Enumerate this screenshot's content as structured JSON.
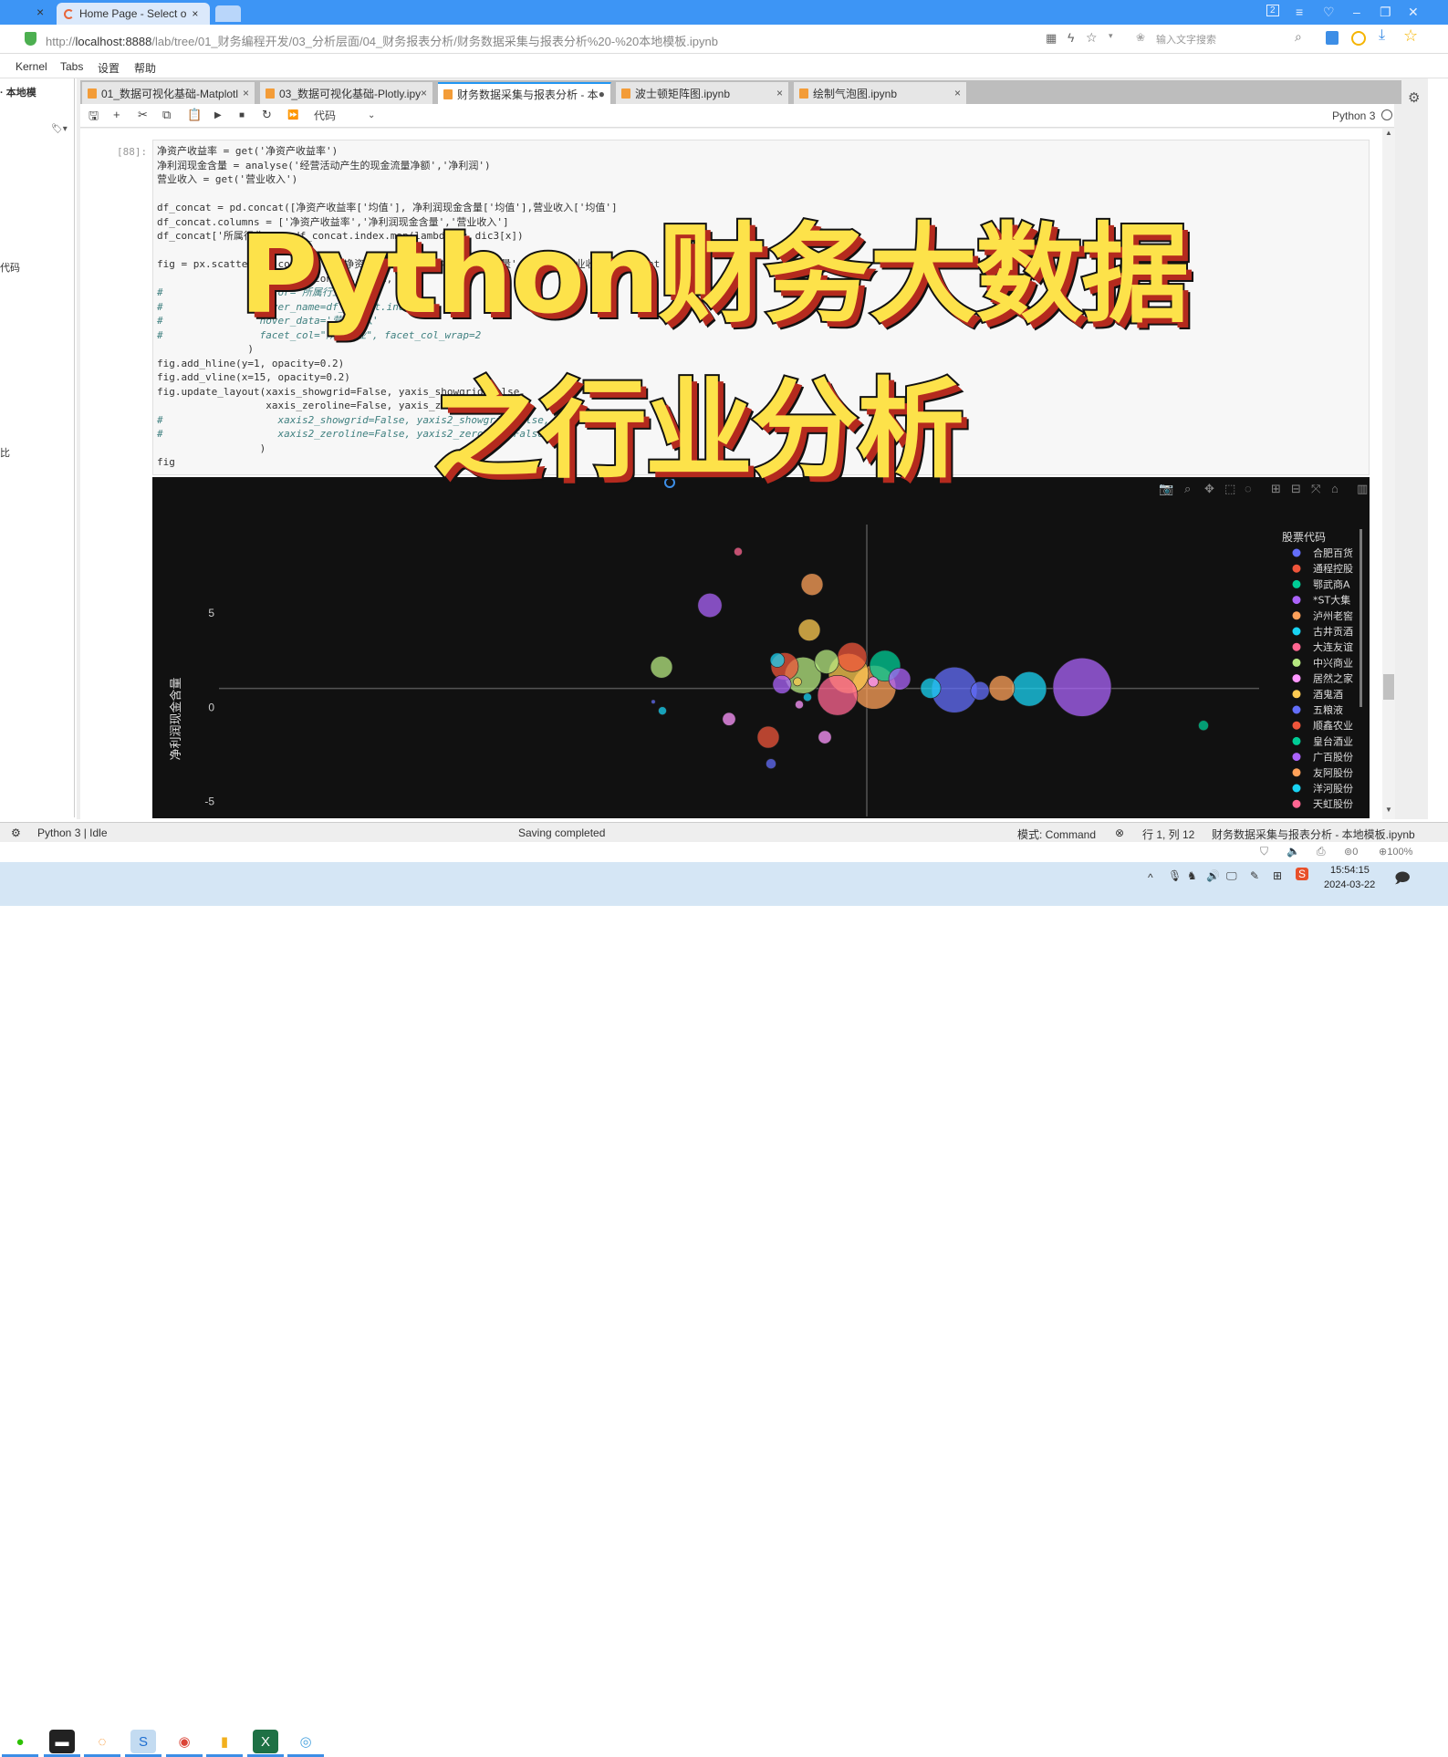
{
  "browser": {
    "tabs": [
      {
        "label": "Home Page - Select o",
        "close": "×"
      }
    ],
    "prev_tab_close": "×",
    "url_prefix": "http://",
    "url_host": "localhost:8888",
    "url_path": "/lab/tree/01_财务编程开发/03_分析层面/04_财务报表分析/财务数据采集与报表分析%20-%20本地模板.ipynb",
    "search_placeholder": "输入文字搜索",
    "window_badge": "2",
    "zoom": "100%",
    "block_count": "0"
  },
  "menu": [
    "Kernel",
    "Tabs",
    "设置",
    "帮助"
  ],
  "sidebar": {
    "items": [
      "· 本地模",
      "代码",
      "比"
    ]
  },
  "notebook_tabs": [
    {
      "label": "01_数据可视化基础-Matplotl",
      "close": "×"
    },
    {
      "label": "03_数据可视化基础-Plotly.ipy",
      "close": "×"
    },
    {
      "label": "财务数据采集与报表分析 - 本",
      "close": "●",
      "active": true
    },
    {
      "label": "波士顿矩阵图.ipynb",
      "close": "×"
    },
    {
      "label": "绘制气泡图.ipynb",
      "close": "×"
    }
  ],
  "toolbar": {
    "cell_type": "代码",
    "kernel": "Python 3"
  },
  "cell": {
    "prompt": "[88]:",
    "lines": [
      "净资产收益率 = get('净资产收益率')",
      "净利润现金含量 = analyse('经营活动产生的现金流量净额','净利润')",
      "营业收入 = get('营业收入')",
      "",
      "df_concat = pd.concat([净资产收益率['均值'], 净利润现金含量['均值'],营业收入['均值']",
      "df_concat.columns = ['净资产收益率','净利润现金含量','营业收入']",
      "df_concat['所属行业'] = df_concat.index.map(lambda x: dic3[x])",
      "",
      "fig = px.scatter(df_concat, x='净资产收益率', y='净利润现金含量', size='营业收入', height",
      "                 color=df_concat.index,",
      "#                color='所属行业',",
      "#                hover_name=df_concat.index,",
      "#                hover_data='营业收入'",
      "#                facet_col=\"所属行业\", facet_col_wrap=2",
      "               )",
      "fig.add_hline(y=1, opacity=0.2)",
      "fig.add_vline(x=15, opacity=0.2)",
      "fig.update_layout(xaxis_showgrid=False, yaxis_showgrid=False,",
      "                  xaxis_zeroline=False, yaxis_zeroline=False,",
      "#                   xaxis2_showgrid=False, yaxis2_showgrid=False,",
      "#                   xaxis2_zeroline=False, yaxis2_zeroline=False",
      "                 )",
      "fig"
    ]
  },
  "overlay": {
    "line1": "Python财务大数据",
    "line2": "之行业分析"
  },
  "chart_data": {
    "type": "scatter",
    "ylabel": "净利润现金含量",
    "yticks": [
      "5",
      "0",
      "-5"
    ],
    "ylim": [
      -5.8,
      9.7
    ],
    "xlim": [
      -20.5,
      36.5
    ],
    "hline_y": 1,
    "vline_x": 15,
    "grid": false,
    "legend_title": "股票代码",
    "legend_placement": "right",
    "legend": [
      "合肥百货",
      "通程控股",
      "鄂武商A",
      "*ST大集",
      "泸州老窖",
      "古井贡酒",
      "大连友谊",
      "中兴商业",
      "居然之家",
      "酒鬼酒",
      "五粮液",
      "顺鑫农业",
      "皇台酒业",
      "广百股份",
      "友阿股份",
      "洋河股份",
      "天虹股份"
    ],
    "colors": [
      "#636efa",
      "#ef553b",
      "#00cc96",
      "#ab63fa",
      "#ffa15a",
      "#19d3f3",
      "#ff6692",
      "#b6e880",
      "#ff97ff",
      "#fecb52"
    ],
    "points": [
      {
        "x": 26.8,
        "y": 1.06,
        "size": 100,
        "c": 3
      },
      {
        "x": 23.9,
        "y": 0.97,
        "size": 35,
        "c": 5
      },
      {
        "x": 22.4,
        "y": 1.01,
        "size": 19,
        "c": 4
      },
      {
        "x": 21.2,
        "y": 0.87,
        "size": 10,
        "c": 0
      },
      {
        "x": 19.8,
        "y": 0.92,
        "size": 61,
        "c": 0
      },
      {
        "x": 18.5,
        "y": 1.01,
        "size": 12,
        "c": 5
      },
      {
        "x": 16.8,
        "y": 1.5,
        "size": 14,
        "c": 3
      },
      {
        "x": 15.4,
        "y": 1.06,
        "size": 56,
        "c": 4
      },
      {
        "x": 16.0,
        "y": 2.2,
        "size": 28,
        "c": 2
      },
      {
        "x": 14.2,
        "y": 2.66,
        "size": 25,
        "c": 1
      },
      {
        "x": 14.0,
        "y": 1.79,
        "size": 47,
        "c": 9
      },
      {
        "x": 13.4,
        "y": 0.63,
        "size": 47,
        "c": 6
      },
      {
        "x": 15.35,
        "y": 1.35,
        "size": 3,
        "c": 8
      },
      {
        "x": 12.8,
        "y": 2.42,
        "size": 17,
        "c": 7
      },
      {
        "x": 11.5,
        "y": 1.69,
        "size": 39,
        "c": 7
      },
      {
        "x": 10.5,
        "y": 2.17,
        "size": 22,
        "c": 1
      },
      {
        "x": 10.1,
        "y": 2.5,
        "size": 6,
        "c": 5
      },
      {
        "x": 10.35,
        "y": 1.21,
        "size": 10,
        "c": 3
      },
      {
        "x": 11.2,
        "y": 1.35,
        "size": 2,
        "c": 9
      },
      {
        "x": 11.75,
        "y": 0.53,
        "size": 2,
        "c": 5
      },
      {
        "x": 11.3,
        "y": 0.14,
        "size": 2,
        "c": 8
      },
      {
        "x": 3.75,
        "y": 2.13,
        "size": 14,
        "c": 7
      },
      {
        "x": 6.4,
        "y": 5.41,
        "size": 17,
        "c": 3
      },
      {
        "x": 12.0,
        "y": 6.52,
        "size": 14,
        "c": 4
      },
      {
        "x": 11.85,
        "y": 4.1,
        "size": 14,
        "c": 9
      },
      {
        "x": 7.95,
        "y": 8.26,
        "size": 2,
        "c": 6
      },
      {
        "x": 3.8,
        "y": -0.19,
        "size": 2,
        "c": 5
      },
      {
        "x": 3.3,
        "y": 0.29,
        "size": 0.5,
        "c": 0
      },
      {
        "x": 7.45,
        "y": -0.63,
        "size": 5,
        "c": 8
      },
      {
        "x": 9.6,
        "y": -1.59,
        "size": 14,
        "c": 1
      },
      {
        "x": 12.7,
        "y": -1.59,
        "size": 5,
        "c": 8
      },
      {
        "x": 9.75,
        "y": -3.0,
        "size": 3,
        "c": 0
      },
      {
        "x": 33.45,
        "y": -0.97,
        "size": 3,
        "c": 2
      }
    ]
  },
  "status": {
    "kernel": "Python 3 | Idle",
    "message": "Saving completed",
    "mode": "模式: Command",
    "position": "行 1, 列 12",
    "file": "财务数据采集与报表分析 - 本地模板.ipynb"
  },
  "clock": {
    "time": "15:54:15",
    "date": "2024-03-22"
  }
}
